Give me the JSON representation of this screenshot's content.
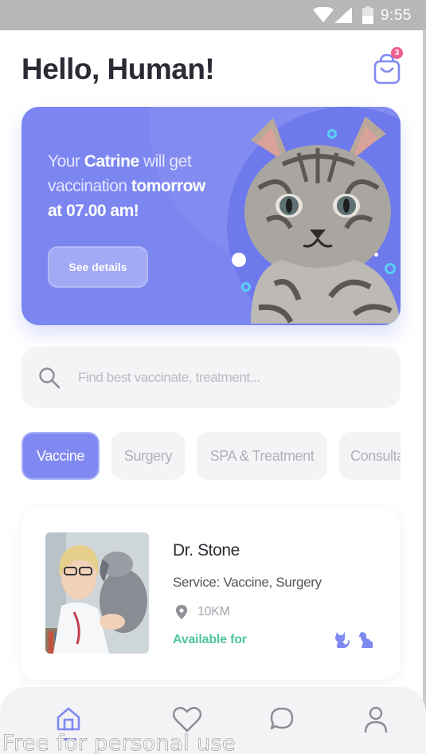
{
  "status_bar": {
    "time": "9:55"
  },
  "header": {
    "greeting": "Hello, Human!",
    "cart_badge": "3"
  },
  "banner": {
    "line1_prefix": "Your ",
    "pet_name": "Catrine",
    "line1_suffix": " will get",
    "line2_prefix": "vaccination ",
    "line2_bold": "tomorrow",
    "line3": "at 07.00 am!",
    "button_label": "See details"
  },
  "search": {
    "placeholder": "Find best vaccinate, treatment..."
  },
  "categories": [
    {
      "label": "Vaccine",
      "active": true
    },
    {
      "label": "Surgery",
      "active": false
    },
    {
      "label": "SPA & Treatment",
      "active": false
    },
    {
      "label": "Consultation",
      "active": false
    }
  ],
  "doctor": {
    "name": "Dr. Stone",
    "service": "Service: Vaccine, Surgery",
    "distance": "10KM",
    "available_label": "Available for"
  },
  "tab_bar": {
    "items": [
      {
        "icon": "home-icon",
        "active": true
      },
      {
        "icon": "heart-icon",
        "active": false
      },
      {
        "icon": "chat-icon",
        "active": false
      },
      {
        "icon": "profile-icon",
        "active": false
      }
    ]
  },
  "watermark": "Free for personal use",
  "colors": {
    "accent": "#7f89f1",
    "available": "#4fc59a",
    "badge": "#ef5c8b"
  }
}
